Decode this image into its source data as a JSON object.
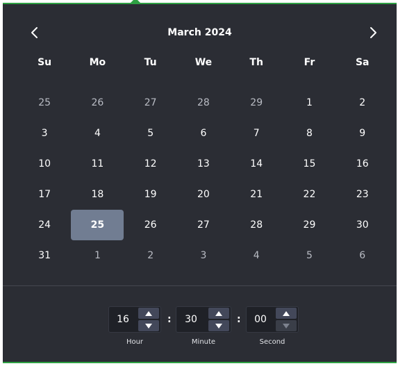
{
  "header": {
    "title": "March 2024",
    "prev_icon": "chevron-left-icon",
    "next_icon": "chevron-right-icon"
  },
  "weekdays": [
    "Su",
    "Mo",
    "Tu",
    "We",
    "Th",
    "Fr",
    "Sa"
  ],
  "weeks": [
    [
      {
        "d": "25",
        "o": true
      },
      {
        "d": "26",
        "o": true
      },
      {
        "d": "27",
        "o": true
      },
      {
        "d": "28",
        "o": true
      },
      {
        "d": "29",
        "o": true
      },
      {
        "d": "1"
      },
      {
        "d": "2"
      }
    ],
    [
      {
        "d": "3"
      },
      {
        "d": "4"
      },
      {
        "d": "5"
      },
      {
        "d": "6"
      },
      {
        "d": "7"
      },
      {
        "d": "8"
      },
      {
        "d": "9"
      }
    ],
    [
      {
        "d": "10"
      },
      {
        "d": "11"
      },
      {
        "d": "12"
      },
      {
        "d": "13"
      },
      {
        "d": "14"
      },
      {
        "d": "15"
      },
      {
        "d": "16"
      }
    ],
    [
      {
        "d": "17"
      },
      {
        "d": "18"
      },
      {
        "d": "19"
      },
      {
        "d": "20"
      },
      {
        "d": "21"
      },
      {
        "d": "22"
      },
      {
        "d": "23"
      }
    ],
    [
      {
        "d": "24"
      },
      {
        "d": "25",
        "selected": true
      },
      {
        "d": "26"
      },
      {
        "d": "27"
      },
      {
        "d": "28"
      },
      {
        "d": "29"
      },
      {
        "d": "30"
      }
    ],
    [
      {
        "d": "31"
      },
      {
        "d": "1",
        "o": true
      },
      {
        "d": "2",
        "o": true
      },
      {
        "d": "3",
        "o": true
      },
      {
        "d": "4",
        "o": true
      },
      {
        "d": "5",
        "o": true
      },
      {
        "d": "6",
        "o": true
      }
    ]
  ],
  "time": {
    "hour": {
      "value": "16",
      "label": "Hour"
    },
    "minute": {
      "value": "30",
      "label": "Minute"
    },
    "second": {
      "value": "00",
      "label": "Second"
    },
    "separator": ":"
  },
  "colors": {
    "background": "#2b2d34",
    "accent": "#2ea043",
    "selected": "#717d92"
  }
}
